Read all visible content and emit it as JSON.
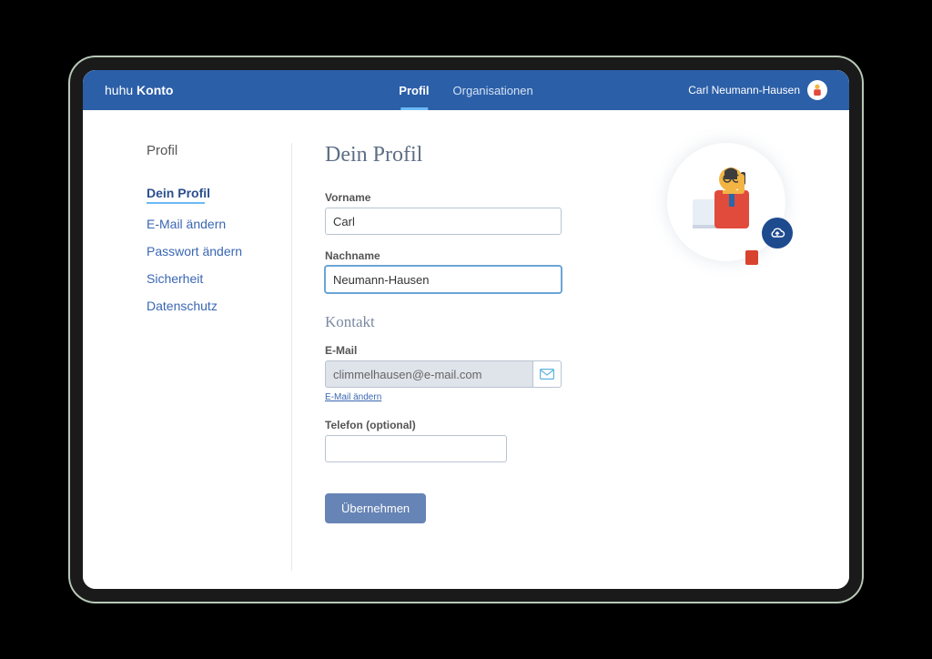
{
  "brand": {
    "prefix": "huhu",
    "name": "Konto"
  },
  "tabs": [
    {
      "label": "Profil",
      "active": true
    },
    {
      "label": "Organisationen",
      "active": false
    }
  ],
  "user": {
    "display_name": "Carl Neumann-Hausen"
  },
  "sidebar": {
    "title": "Profil",
    "items": [
      {
        "label": "Dein Profil",
        "active": true
      },
      {
        "label": "E-Mail ändern",
        "active": false
      },
      {
        "label": "Passwort ändern",
        "active": false
      },
      {
        "label": "Sicherheit",
        "active": false
      },
      {
        "label": "Datenschutz",
        "active": false
      }
    ]
  },
  "form": {
    "heading": "Dein Profil",
    "vorname_label": "Vorname",
    "vorname_value": "Carl",
    "nachname_label": "Nachname",
    "nachname_value": "Neumann-Hausen",
    "kontakt_heading": "Kontakt",
    "email_label": "E-Mail",
    "email_value": "climmelhausen@e-mail.com",
    "email_change_link": "E-Mail ändern",
    "telefon_label": "Telefon (optional)",
    "telefon_value": "",
    "submit_label": "Übernehmen"
  }
}
